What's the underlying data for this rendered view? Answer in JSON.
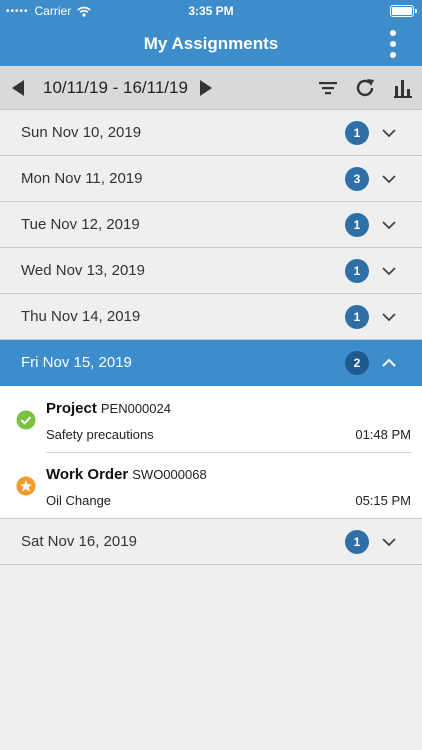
{
  "status_bar": {
    "carrier": "Carrier",
    "time": "3:35 PM"
  },
  "header": {
    "title": "My Assignments",
    "menu_icon": "more-vertical-icon"
  },
  "toolbar": {
    "date_range": "10/11/19 - 16/11/19",
    "icons": [
      "previous-arrow-icon",
      "next-arrow-icon",
      "filter-icon",
      "refresh-icon",
      "chart-icon"
    ]
  },
  "days": [
    {
      "label": "Sun Nov 10, 2019",
      "count": "1",
      "expanded": false
    },
    {
      "label": "Mon Nov 11, 2019",
      "count": "3",
      "expanded": false
    },
    {
      "label": "Tue Nov 12, 2019",
      "count": "1",
      "expanded": false
    },
    {
      "label": "Wed Nov 13, 2019",
      "count": "1",
      "expanded": false
    },
    {
      "label": "Thu Nov 14, 2019",
      "count": "1",
      "expanded": false
    },
    {
      "label": "Fri Nov 15, 2019",
      "count": "2",
      "expanded": true
    },
    {
      "label": "Sat Nov 16, 2019",
      "count": "1",
      "expanded": false
    }
  ],
  "assignments": [
    {
      "type": "Project",
      "ref": "PEN000024",
      "description": "Safety precautions",
      "time": "01:48 PM",
      "status_icon": "check-circle-icon",
      "status_color": "#7cc242"
    },
    {
      "type": "Work Order",
      "ref": "SWO000068",
      "description": "Oil Change",
      "time": "05:15 PM",
      "status_icon": "star-circle-icon",
      "status_color": "#f39a2b"
    }
  ],
  "colors": {
    "header": "#3d8ccb",
    "badge": "#2f6fa7",
    "toolbar": "#d9d9d9"
  }
}
